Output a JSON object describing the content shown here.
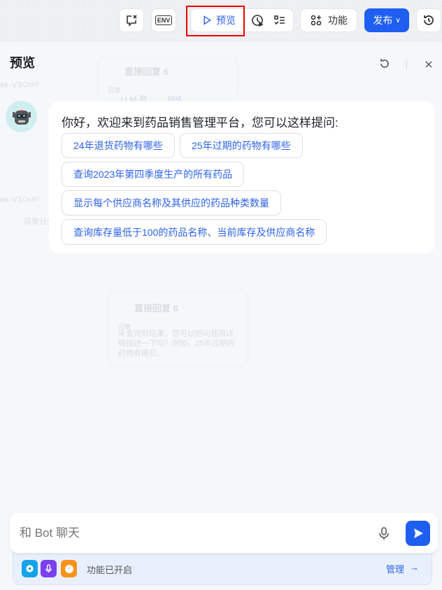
{
  "toolbar": {
    "env_label": "ENV",
    "preview_label": "预览",
    "features_label": "功能",
    "publish_label": "发布"
  },
  "background": {
    "node6_title": "直接回复 6",
    "node6_field": "回复",
    "node6_ref": "LLM-数...",
    "node6_var": "text",
    "model1": "ek-V3",
    "chat1": "CHAT",
    "model2": "ek-V3",
    "chat2": "CHAT",
    "branch": "异常分支",
    "node8_title": "直接回复 8",
    "node8_field": "回复",
    "node8_text": "未查询到结果，您可以把问题再详细描述一下吗？例如，25年过期的药物有哪些。"
  },
  "panel": {
    "title": "预览"
  },
  "chat": {
    "greeting": "你好，欢迎来到药品销售管理平台，您可以这样提问:",
    "suggestions": [
      "24年退货药物有哪些",
      "25年过期的药物有哪些",
      "查询2023年第四季度生产的所有药品",
      "显示每个供应商名称及其供应的药品种类数量",
      "查询库存量低于100的药品名称、当前库存及供应商名称"
    ]
  },
  "input": {
    "placeholder": "和 Bot 聊天"
  },
  "features": {
    "status": "功能已开启",
    "manage": "管理"
  },
  "colors": {
    "accent": "#1e5ef0",
    "highlight": "#e00000"
  }
}
